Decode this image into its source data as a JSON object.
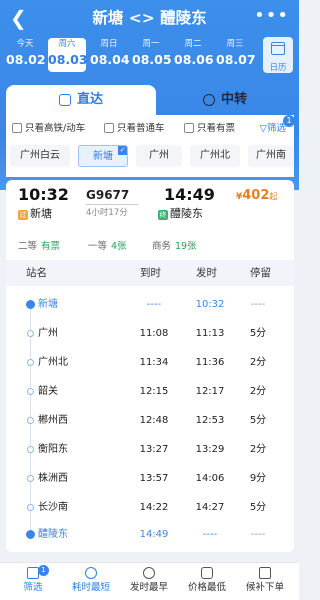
{
  "header": {
    "title": "新塘 <> 醴陵东",
    "dates": [
      {
        "weekday": "今天",
        "date": "08.02"
      },
      {
        "weekday": "周六",
        "date": "08.03"
      },
      {
        "weekday": "周日",
        "date": "08.04"
      },
      {
        "weekday": "周一",
        "date": "08.05"
      },
      {
        "weekday": "周二",
        "date": "08.06"
      },
      {
        "weekday": "周三",
        "date": "08.07"
      }
    ],
    "calendar_label": "日历"
  },
  "tabs": {
    "direct": "直达",
    "transfer": "中转"
  },
  "filters": {
    "high_speed": "只看高铁/动车",
    "normal": "只看普通车",
    "available": "只看有票",
    "filter_label": "筛选",
    "filter_badge": "1"
  },
  "stations": [
    "广州白云",
    "新塘",
    "广州",
    "广州北",
    "广州南"
  ],
  "train": {
    "depart_time": "10:32",
    "depart_station": "新塘",
    "depart_tag": "过",
    "number": "G9677",
    "duration": "4小时17分",
    "arrive_time": "14:49",
    "arrive_station": "醴陵东",
    "arrive_tag": "终",
    "price_symbol": "¥",
    "price": "402",
    "price_suffix": "起",
    "seats": [
      {
        "class": "二等",
        "status": "有票"
      },
      {
        "class": "一等",
        "status": "4张"
      },
      {
        "class": "商务",
        "status": "19张"
      }
    ]
  },
  "stop_table": {
    "headers": {
      "station": "站名",
      "arrive": "到时",
      "depart": "发时",
      "stay": "停留"
    },
    "rows": [
      {
        "station": "新塘",
        "arrive": "----",
        "depart": "10:32",
        "stay": "----"
      },
      {
        "station": "广州",
        "arrive": "11:08",
        "depart": "11:13",
        "stay": "5分"
      },
      {
        "station": "广州北",
        "arrive": "11:34",
        "depart": "11:36",
        "stay": "2分"
      },
      {
        "station": "韶关",
        "arrive": "12:15",
        "depart": "12:17",
        "stay": "2分"
      },
      {
        "station": "郴州西",
        "arrive": "12:48",
        "depart": "12:53",
        "stay": "5分"
      },
      {
        "station": "衡阳东",
        "arrive": "13:27",
        "depart": "13:29",
        "stay": "2分"
      },
      {
        "station": "株洲西",
        "arrive": "13:57",
        "depart": "14:06",
        "stay": "9分"
      },
      {
        "station": "长沙南",
        "arrive": "14:22",
        "depart": "14:27",
        "stay": "5分"
      },
      {
        "station": "醴陵东",
        "arrive": "14:49",
        "depart": "----",
        "stay": "----"
      }
    ]
  },
  "bottom_nav": {
    "filter": "筛选",
    "filter_badge": "1",
    "shortest": "耗时最短",
    "earliest": "发时最早",
    "cheapest": "价格最低",
    "waitlist": "候补下单"
  }
}
